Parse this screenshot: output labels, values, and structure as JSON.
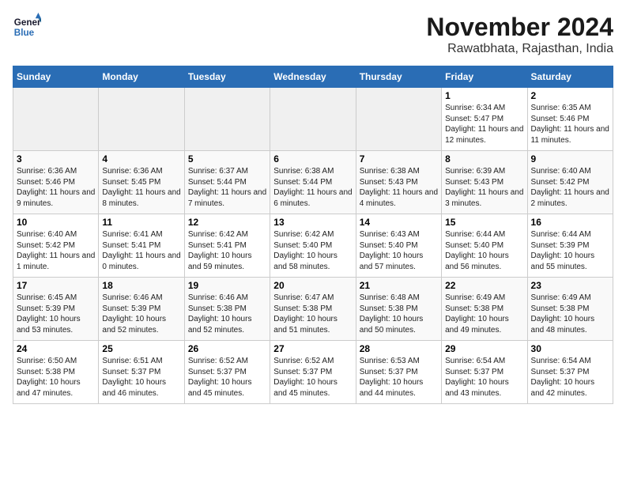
{
  "logo": {
    "line1": "General",
    "line2": "Blue"
  },
  "header": {
    "month": "November 2024",
    "location": "Rawatbhata, Rajasthan, India"
  },
  "weekdays": [
    "Sunday",
    "Monday",
    "Tuesday",
    "Wednesday",
    "Thursday",
    "Friday",
    "Saturday"
  ],
  "weeks": [
    [
      {
        "day": "",
        "info": ""
      },
      {
        "day": "",
        "info": ""
      },
      {
        "day": "",
        "info": ""
      },
      {
        "day": "",
        "info": ""
      },
      {
        "day": "",
        "info": ""
      },
      {
        "day": "1",
        "info": "Sunrise: 6:34 AM\nSunset: 5:47 PM\nDaylight: 11 hours and 12 minutes."
      },
      {
        "day": "2",
        "info": "Sunrise: 6:35 AM\nSunset: 5:46 PM\nDaylight: 11 hours and 11 minutes."
      }
    ],
    [
      {
        "day": "3",
        "info": "Sunrise: 6:36 AM\nSunset: 5:46 PM\nDaylight: 11 hours and 9 minutes."
      },
      {
        "day": "4",
        "info": "Sunrise: 6:36 AM\nSunset: 5:45 PM\nDaylight: 11 hours and 8 minutes."
      },
      {
        "day": "5",
        "info": "Sunrise: 6:37 AM\nSunset: 5:44 PM\nDaylight: 11 hours and 7 minutes."
      },
      {
        "day": "6",
        "info": "Sunrise: 6:38 AM\nSunset: 5:44 PM\nDaylight: 11 hours and 6 minutes."
      },
      {
        "day": "7",
        "info": "Sunrise: 6:38 AM\nSunset: 5:43 PM\nDaylight: 11 hours and 4 minutes."
      },
      {
        "day": "8",
        "info": "Sunrise: 6:39 AM\nSunset: 5:43 PM\nDaylight: 11 hours and 3 minutes."
      },
      {
        "day": "9",
        "info": "Sunrise: 6:40 AM\nSunset: 5:42 PM\nDaylight: 11 hours and 2 minutes."
      }
    ],
    [
      {
        "day": "10",
        "info": "Sunrise: 6:40 AM\nSunset: 5:42 PM\nDaylight: 11 hours and 1 minute."
      },
      {
        "day": "11",
        "info": "Sunrise: 6:41 AM\nSunset: 5:41 PM\nDaylight: 11 hours and 0 minutes."
      },
      {
        "day": "12",
        "info": "Sunrise: 6:42 AM\nSunset: 5:41 PM\nDaylight: 10 hours and 59 minutes."
      },
      {
        "day": "13",
        "info": "Sunrise: 6:42 AM\nSunset: 5:40 PM\nDaylight: 10 hours and 58 minutes."
      },
      {
        "day": "14",
        "info": "Sunrise: 6:43 AM\nSunset: 5:40 PM\nDaylight: 10 hours and 57 minutes."
      },
      {
        "day": "15",
        "info": "Sunrise: 6:44 AM\nSunset: 5:40 PM\nDaylight: 10 hours and 56 minutes."
      },
      {
        "day": "16",
        "info": "Sunrise: 6:44 AM\nSunset: 5:39 PM\nDaylight: 10 hours and 55 minutes."
      }
    ],
    [
      {
        "day": "17",
        "info": "Sunrise: 6:45 AM\nSunset: 5:39 PM\nDaylight: 10 hours and 53 minutes."
      },
      {
        "day": "18",
        "info": "Sunrise: 6:46 AM\nSunset: 5:39 PM\nDaylight: 10 hours and 52 minutes."
      },
      {
        "day": "19",
        "info": "Sunrise: 6:46 AM\nSunset: 5:38 PM\nDaylight: 10 hours and 52 minutes."
      },
      {
        "day": "20",
        "info": "Sunrise: 6:47 AM\nSunset: 5:38 PM\nDaylight: 10 hours and 51 minutes."
      },
      {
        "day": "21",
        "info": "Sunrise: 6:48 AM\nSunset: 5:38 PM\nDaylight: 10 hours and 50 minutes."
      },
      {
        "day": "22",
        "info": "Sunrise: 6:49 AM\nSunset: 5:38 PM\nDaylight: 10 hours and 49 minutes."
      },
      {
        "day": "23",
        "info": "Sunrise: 6:49 AM\nSunset: 5:38 PM\nDaylight: 10 hours and 48 minutes."
      }
    ],
    [
      {
        "day": "24",
        "info": "Sunrise: 6:50 AM\nSunset: 5:38 PM\nDaylight: 10 hours and 47 minutes."
      },
      {
        "day": "25",
        "info": "Sunrise: 6:51 AM\nSunset: 5:37 PM\nDaylight: 10 hours and 46 minutes."
      },
      {
        "day": "26",
        "info": "Sunrise: 6:52 AM\nSunset: 5:37 PM\nDaylight: 10 hours and 45 minutes."
      },
      {
        "day": "27",
        "info": "Sunrise: 6:52 AM\nSunset: 5:37 PM\nDaylight: 10 hours and 45 minutes."
      },
      {
        "day": "28",
        "info": "Sunrise: 6:53 AM\nSunset: 5:37 PM\nDaylight: 10 hours and 44 minutes."
      },
      {
        "day": "29",
        "info": "Sunrise: 6:54 AM\nSunset: 5:37 PM\nDaylight: 10 hours and 43 minutes."
      },
      {
        "day": "30",
        "info": "Sunrise: 6:54 AM\nSunset: 5:37 PM\nDaylight: 10 hours and 42 minutes."
      }
    ]
  ]
}
